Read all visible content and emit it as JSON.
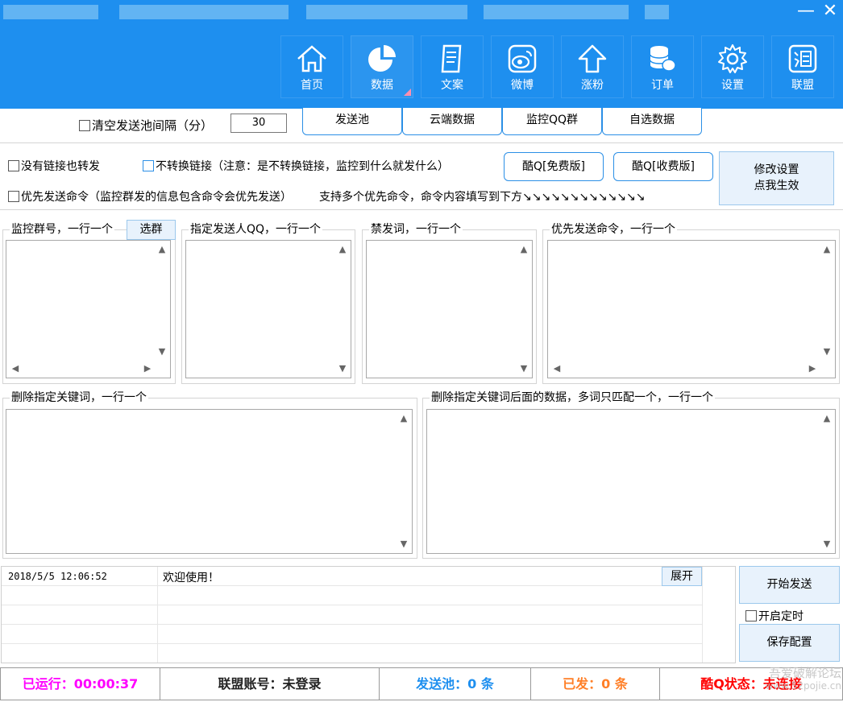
{
  "window": {
    "minimize": "—",
    "close": "✕"
  },
  "nav": [
    {
      "label": "首页",
      "icon": "home-icon"
    },
    {
      "label": "数据",
      "icon": "pie-chart-icon"
    },
    {
      "label": "文案",
      "icon": "document-icon"
    },
    {
      "label": "微博",
      "icon": "weibo-icon"
    },
    {
      "label": "涨粉",
      "icon": "arrow-up-icon"
    },
    {
      "label": "订单",
      "icon": "coins-icon"
    },
    {
      "label": "设置",
      "icon": "gear-icon"
    },
    {
      "label": "联盟",
      "icon": "alliance-icon"
    }
  ],
  "options": {
    "clear_pool_label": "清空发送池间隔（分）",
    "clear_pool_value": "30",
    "no_link_forward": "没有链接也转发",
    "no_convert_link": "不转换链接（注意：是不转换链接，监控到什么就发什么）",
    "priority_cmd": "优先发送命令（监控群发的信息包含命令会优先发送）",
    "priority_note": "支持多个优先命令，命令内容填写到下方↘↘↘↘↘↘↘↘↘↘↘↘↘"
  },
  "tabs": [
    "发送池",
    "云端数据",
    "监控QQ群",
    "自选数据"
  ],
  "buttons": {
    "kuq_free": "酷Q[免费版]",
    "kuq_paid": "酷Q[收费版]",
    "apply_line1": "修改设置",
    "apply_line2": "点我生效",
    "select_group": "选群",
    "expand": "展开",
    "start_send": "开始发送",
    "enable_timer": "开启定时",
    "save_config": "保存配置"
  },
  "groups": {
    "monitor_groups": "监控群号，一行一个",
    "sender_qq": "指定发送人QQ，一行一个",
    "banned_words": "禁发词，一行一个",
    "priority_cmds": "优先发送命令，一行一个",
    "delete_keywords": "删除指定关键词，一行一个",
    "delete_after_keywords": "删除指定关键词后面的数据，多词只匹配一个，一行一个"
  },
  "log": {
    "rows": [
      {
        "time": "2018/5/5 12:06:52",
        "message": "欢迎使用！"
      }
    ]
  },
  "status": {
    "runtime": "已运行：00:00:37",
    "account": "联盟账号：未登录",
    "pool": "发送池：0 条",
    "sent": "已发：0 条",
    "kuq_state": "酷Q状态：未连接"
  },
  "watermark": {
    "line1": "吾爱破解论坛",
    "line2": "www.52pojie.cn"
  },
  "colors": {
    "brand": "#1e8fef",
    "runtime": "#ff00ff",
    "pool": "#1e8fef",
    "sent": "#ff7f27",
    "kuq_state": "#ff0000"
  }
}
